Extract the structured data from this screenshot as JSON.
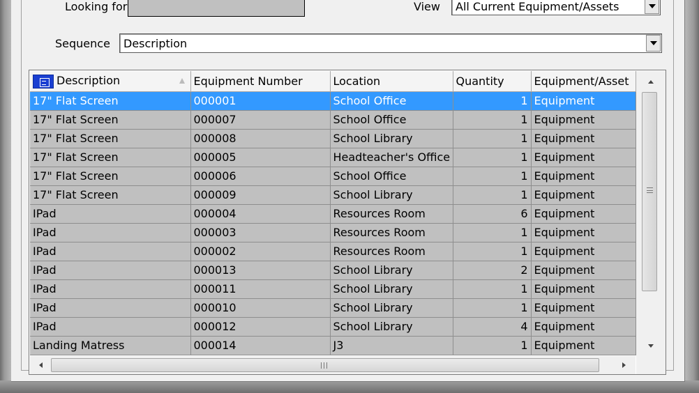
{
  "filters": {
    "looking_for_label": "Looking for",
    "looking_for_value": "",
    "view_label": "View",
    "view_value": "All Current Equipment/Assets",
    "sequence_label": "Sequence",
    "sequence_value": "Description"
  },
  "grid": {
    "columns": [
      "Description",
      "Equipment Number",
      "Location",
      "Quantity",
      "Equipment/Asset"
    ],
    "selected_row": 0,
    "rows": [
      [
        "17\" Flat Screen",
        "000001",
        "School Office",
        "1",
        "Equipment"
      ],
      [
        "17\" Flat Screen",
        "000007",
        "School Office",
        "1",
        "Equipment"
      ],
      [
        "17\" Flat Screen",
        "000008",
        "School Library",
        "1",
        "Equipment"
      ],
      [
        "17\" Flat Screen",
        "000005",
        "Headteacher's Office",
        "1",
        "Equipment"
      ],
      [
        "17\" Flat Screen",
        "000006",
        "School Office",
        "1",
        "Equipment"
      ],
      [
        "17\" Flat Screen",
        "000009",
        "School Library",
        "1",
        "Equipment"
      ],
      [
        "IPad",
        "000004",
        "Resources Room",
        "6",
        "Equipment"
      ],
      [
        "IPad",
        "000003",
        "Resources Room",
        "1",
        "Equipment"
      ],
      [
        "IPad",
        "000002",
        "Resources Room",
        "1",
        "Equipment"
      ],
      [
        "IPad",
        "000013",
        "School Library",
        "2",
        "Equipment"
      ],
      [
        "IPad",
        "000011",
        "School Library",
        "1",
        "Equipment"
      ],
      [
        "IPad",
        "000010",
        "School Library",
        "1",
        "Equipment"
      ],
      [
        "IPad",
        "000012",
        "School Library",
        "4",
        "Equipment"
      ],
      [
        "Landing Matress",
        "000014",
        "J3",
        "1",
        "Equipment"
      ]
    ]
  },
  "icons": {
    "column_header": "list-icon",
    "sort": "sort-ascending-icon",
    "dropdown": "chevron-down-icon"
  },
  "colors": {
    "selection": "#3399ff",
    "row_background": "#c0c0c0",
    "header_icon": "#1a3fd1"
  }
}
